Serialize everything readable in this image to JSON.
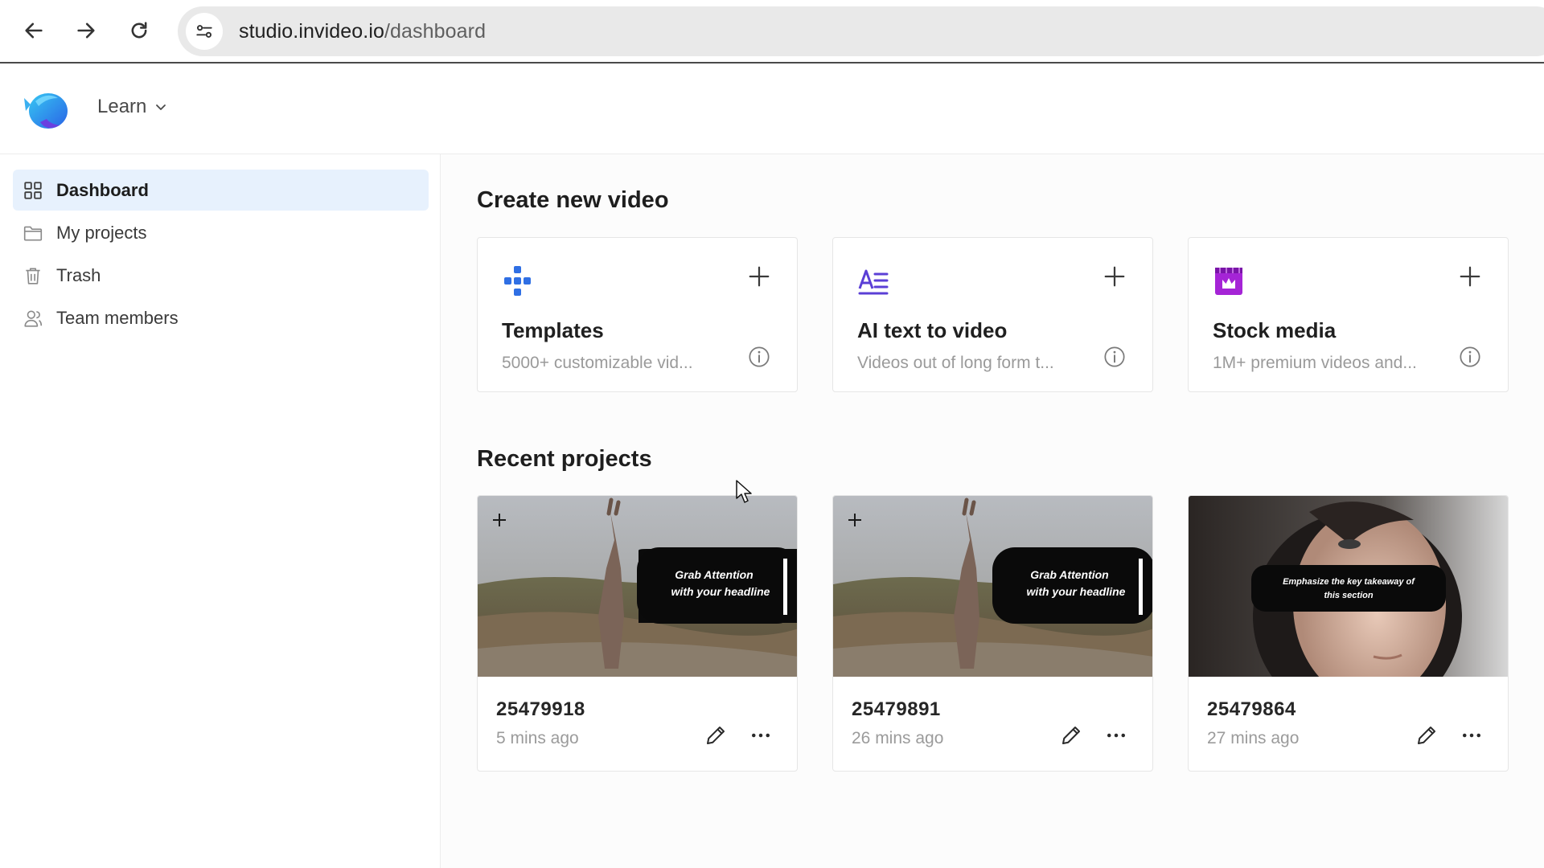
{
  "browser": {
    "url_host": "studio.invideo.io",
    "url_path": "/dashboard"
  },
  "header": {
    "learn_label": "Learn"
  },
  "sidebar": {
    "items": [
      {
        "label": "Dashboard",
        "icon": "grid-icon",
        "active": true
      },
      {
        "label": "My projects",
        "icon": "folder-icon",
        "active": false
      },
      {
        "label": "Trash",
        "icon": "trash-icon",
        "active": false
      },
      {
        "label": "Team members",
        "icon": "team-icon",
        "active": false
      }
    ]
  },
  "main": {
    "create_title": "Create new video",
    "create_cards": [
      {
        "title": "Templates",
        "desc": "5000+ customizable vid...",
        "icon": "templates-icon",
        "color": "#2f6fe4"
      },
      {
        "title": "AI text to video",
        "desc": "Videos out of long form t...",
        "icon": "ai-text-icon",
        "color": "#5b3fd6"
      },
      {
        "title": "Stock media",
        "desc": "1M+ premium videos and...",
        "icon": "stock-media-icon",
        "color": "#a524d6"
      }
    ],
    "recent_title": "Recent projects",
    "projects": [
      {
        "name": "25479918",
        "time": "5 mins ago",
        "overlay_line1": "Grab Attention",
        "overlay_line2": "with your headline"
      },
      {
        "name": "25479891",
        "time": "26 mins ago",
        "overlay_line1": "Grab Attention",
        "overlay_line2": "with your headline"
      },
      {
        "name": "25479864",
        "time": "27 mins ago",
        "overlay_line1": "Emphasize the key takeaway of",
        "overlay_line2": "this section"
      }
    ]
  }
}
